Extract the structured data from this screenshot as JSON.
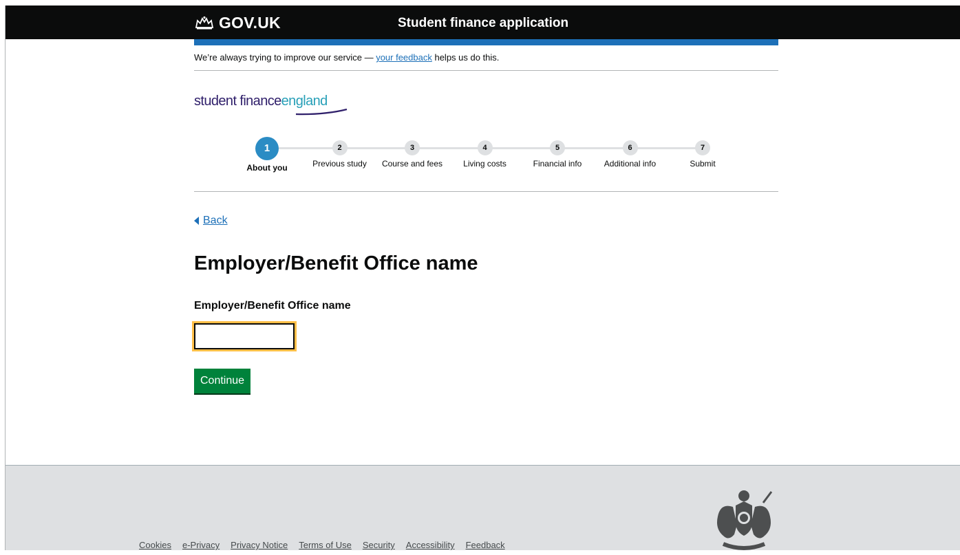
{
  "header": {
    "logo_text": "GOV.UK",
    "service_name": "Student finance application"
  },
  "phase_banner": {
    "text_before": "We’re always trying to improve our service — ",
    "link_text": "your feedback",
    "text_after": " helps us do this."
  },
  "brand": {
    "word1": "student finance",
    "word2": "england"
  },
  "stepper": {
    "active_step": 1,
    "steps": [
      {
        "number": "1",
        "label": "About you"
      },
      {
        "number": "2",
        "label": "Previous study"
      },
      {
        "number": "3",
        "label": "Course and fees"
      },
      {
        "number": "4",
        "label": "Living costs"
      },
      {
        "number": "5",
        "label": "Financial info"
      },
      {
        "number": "6",
        "label": "Additional info"
      },
      {
        "number": "7",
        "label": "Submit"
      }
    ]
  },
  "back_link": "Back",
  "page_title": "Employer/Benefit Office name",
  "form": {
    "field_label": "Employer/Benefit Office name",
    "field_value": "",
    "continue_label": "Continue"
  },
  "footer": {
    "links": [
      "Cookies",
      "e-Privacy",
      "Privacy Notice",
      "Terms of Use",
      "Security",
      "Accessibility",
      "Feedback"
    ]
  },
  "colors": {
    "header_bg": "#0b0c0c",
    "accent_blue": "#1d70b8",
    "step_active": "#2b8cc4",
    "button_green": "#00823b",
    "focus_yellow": "#ffbf47"
  }
}
